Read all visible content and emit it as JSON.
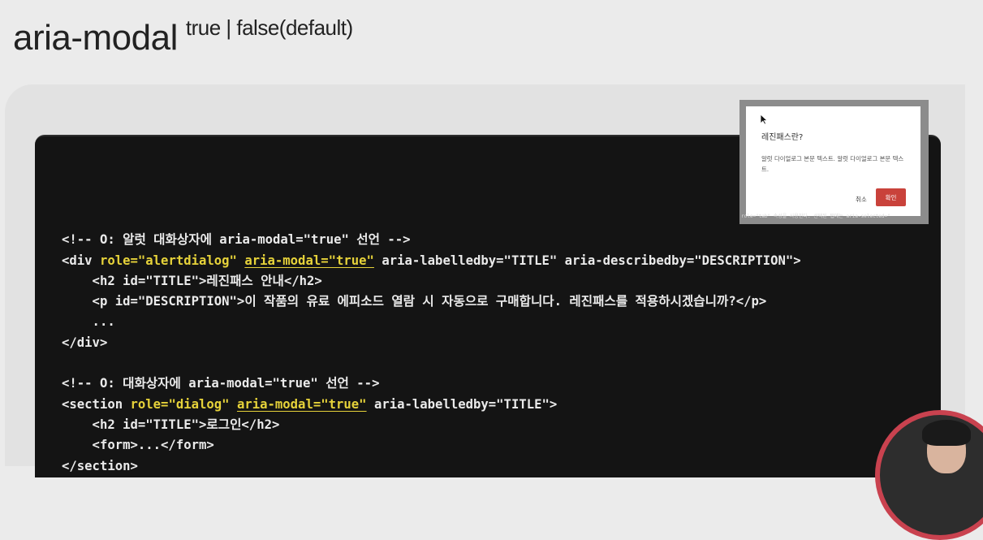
{
  "slide": {
    "title": "aria-modal",
    "title_suffix": "true | false(default)"
  },
  "code_lines": [
    [
      {
        "t": ""
      }
    ],
    [
      {
        "t": "<!-- O: 알럿 대화상자에 aria-modal=\"true\" 선언 -->"
      }
    ],
    [
      {
        "t": "<div "
      },
      {
        "t": "role=\"alertdialog\"",
        "s": "hl"
      },
      {
        "t": " "
      },
      {
        "t": "aria-modal=\"true\"",
        "s": "ul"
      },
      {
        "t": " aria-labelledby=\"TITLE\" aria-describedby=\"DESCRIPTION\">"
      }
    ],
    [
      {
        "t": "    <h2 id=\"TITLE\">레진패스 안내</h2>"
      }
    ],
    [
      {
        "t": "    <p id=\"DESCRIPTION\">이 작품의 유료 에피소드 열람 시 자동으로 구매합니다. 레진패스를 적용하시겠습니까?</p>"
      }
    ],
    [
      {
        "t": "    ..."
      }
    ],
    [
      {
        "t": "</div>"
      }
    ],
    [
      {
        "t": ""
      }
    ],
    [
      {
        "t": "<!-- O: 대화상자에 aria-modal=\"true\" 선언 -->"
      }
    ],
    [
      {
        "t": "<section "
      },
      {
        "t": "role=\"dialog\"",
        "s": "hl"
      },
      {
        "t": " "
      },
      {
        "t": "aria-modal=\"true\"",
        "s": "ul"
      },
      {
        "t": " aria-labelledby=\"TITLE\">"
      }
    ],
    [
      {
        "t": "    <h2 id=\"TITLE\">로그인</h2>"
      }
    ],
    [
      {
        "t": "    <form>...</form>"
      }
    ],
    [
      {
        "t": "</section>"
      }
    ]
  ],
  "dialog_preview": {
    "title": "레진패스란?",
    "body": "알럿 다이얼로그 본문 텍스트. 알럿 다이얼로그 본문 텍스트.",
    "cancel_label": "취소",
    "confirm_label": "확인",
    "strip_text": "role=\"tab\" 속성을 사용한다. 선택된 탭에는 aria-selected=\""
  },
  "colors": {
    "code_background": "#141414",
    "highlight": "#e6d23a",
    "confirm_button": "#c9423b",
    "presenter_ring": "#c9424f"
  },
  "icons": [
    "mouse-cursor-icon"
  ]
}
